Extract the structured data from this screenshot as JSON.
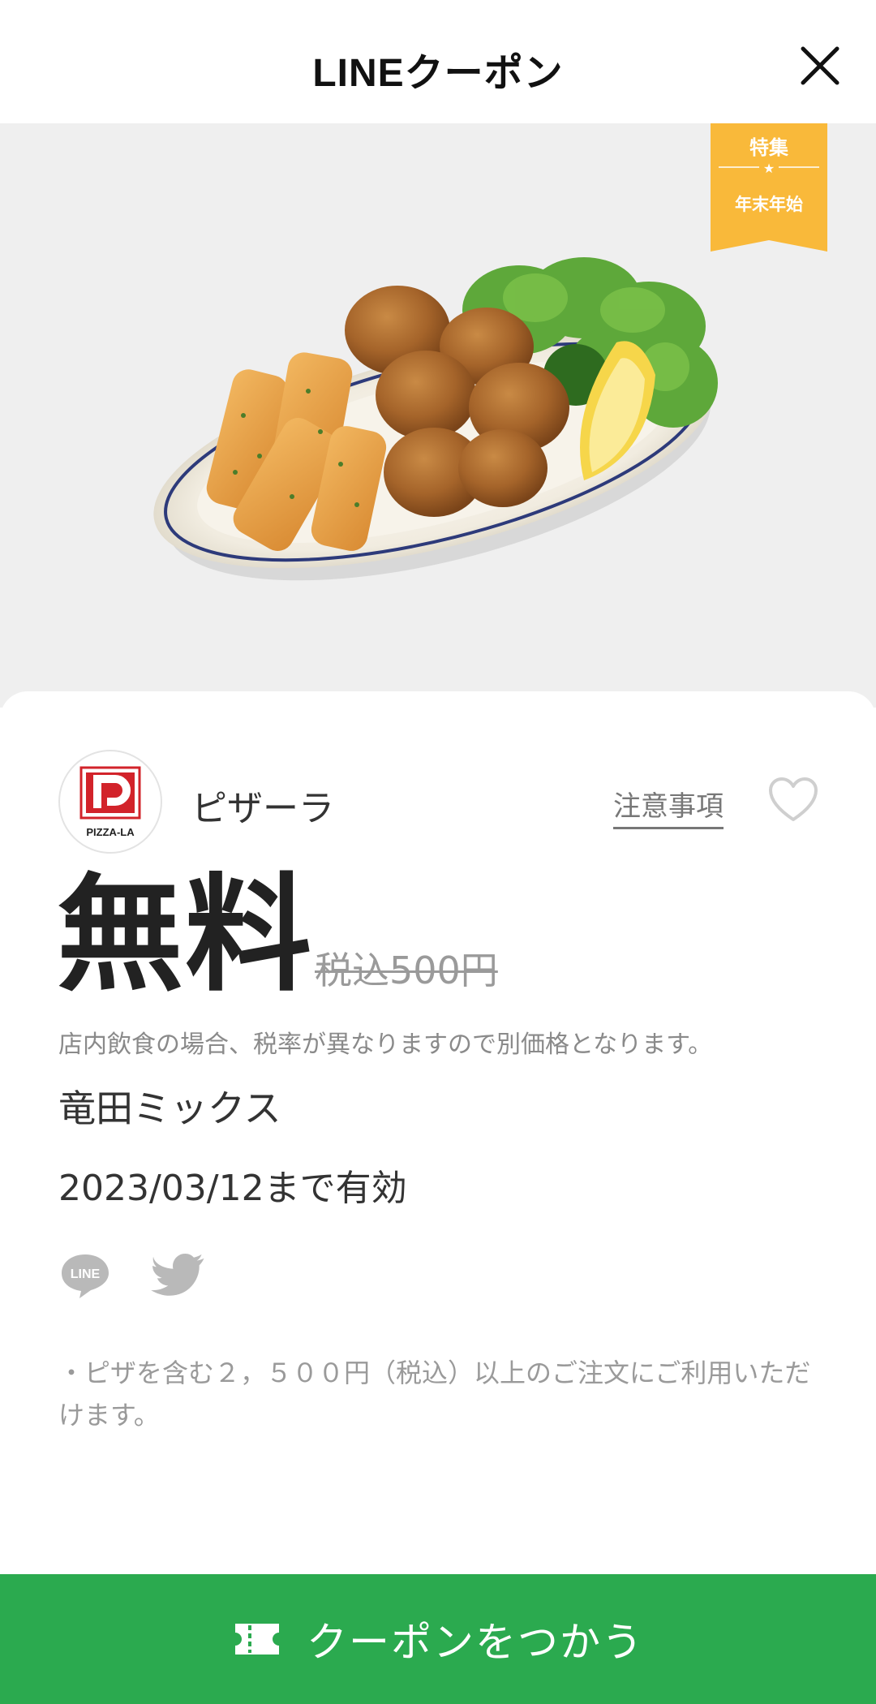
{
  "header": {
    "title": "LINEクーポン",
    "close_icon": "close-icon"
  },
  "hero": {
    "ribbon_top": "特集",
    "ribbon_star": "★",
    "ribbon_bottom": "年末年始",
    "ribbon_color": "#f9b93a",
    "image_subject": "food-photo"
  },
  "coupon": {
    "brand_name": "ピザーラ",
    "logo_text": "PIZZA-LA",
    "notes_label": "注意事項",
    "favorite_icon": "heart-icon",
    "price": "無料",
    "original_price": "税込500円",
    "tax_note": "店内飲食の場合、税率が異なりますので別価格となります。",
    "item_name": "竜田ミックス",
    "validity": "2023/03/12まで有効",
    "share": {
      "line_label": "LINE",
      "line_icon": "line-share-icon",
      "twitter_icon": "twitter-icon"
    },
    "condition": "・ピザを含む２，５００円（税込）以上のご注文にご利用いただけます。"
  },
  "footer": {
    "use_button_label": "クーポンをつかう",
    "ticket_icon": "ticket-icon",
    "accent_color": "#2baa4f"
  }
}
